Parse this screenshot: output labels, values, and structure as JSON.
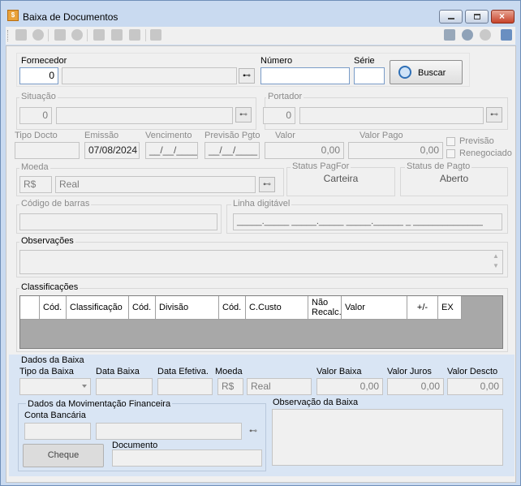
{
  "window": {
    "title": "Baixa de Documentos",
    "icon": "document-app-icon"
  },
  "fornecedor": {
    "label": "Fornecedor",
    "code": "0",
    "name": ""
  },
  "numero": {
    "label": "Número",
    "value": ""
  },
  "serie": {
    "label": "Série",
    "value": ""
  },
  "buscar": {
    "label": "Buscar"
  },
  "situacao": {
    "label": "Situação",
    "code": "0",
    "name": ""
  },
  "portador": {
    "label": "Portador",
    "code": "0",
    "name": ""
  },
  "tipo_docto": {
    "label": "Tipo Docto",
    "value": ""
  },
  "emissao": {
    "label": "Emissão",
    "value": "07/08/2024"
  },
  "vencimento": {
    "label": "Vencimento",
    "value": "__/__/____"
  },
  "previsao_pgto": {
    "label": "Previsão Pgto",
    "value": "__/__/____"
  },
  "valor": {
    "label": "Valor",
    "value": "0,00"
  },
  "valor_pago": {
    "label": "Valor Pago",
    "value": "0,00"
  },
  "previsao_chk": {
    "label": "Previsão"
  },
  "renegociado_chk": {
    "label": "Renegociado"
  },
  "moeda": {
    "label": "Moeda",
    "symbol": "R$",
    "name": "Real"
  },
  "status_pagfor": {
    "label": "Status PagFor",
    "value": "Carteira"
  },
  "status_pagto": {
    "label": "Status de Pagto",
    "value": "Aberto"
  },
  "codigo_barras": {
    "label": "Código de barras",
    "value": ""
  },
  "linha_digitavel": {
    "label": "Linha digitável",
    "value": "_____._____ _____._____ _____.______ _ ______________"
  },
  "observacoes": {
    "label": "Observações",
    "value": ""
  },
  "classificacoes": {
    "label": "Classificações",
    "columns": [
      "Cód.",
      "Classificação",
      "Cód.",
      "Divisão",
      "Cód.",
      "C.Custo",
      "Não Recalc.",
      "Valor",
      "+/-",
      "EX"
    ]
  },
  "dados_baixa": {
    "label": "Dados da Baixa",
    "tipo_label": "Tipo da Baixa",
    "data_baixa_label": "Data Baixa",
    "data_efetiva_label": "Data Efetiva.",
    "moeda_label": "Moeda",
    "moeda_symbol": "R$",
    "moeda_name": "Real",
    "valor_baixa_label": "Valor Baixa",
    "valor_baixa": "0,00",
    "valor_juros_label": "Valor Juros",
    "valor_juros": "0,00",
    "valor_descto_label": "Valor Descto",
    "valor_descto": "0,00"
  },
  "mov_financeira": {
    "label": "Dados da Movimentação Financeira",
    "conta_label": "Conta Bancária",
    "documento_label": "Documento",
    "cheque_label": "Cheque"
  },
  "observacao_baixa": {
    "label": "Observação da Baixa",
    "value": ""
  },
  "toolbar_icons": [
    "edit-icon",
    "cancel-icon",
    "save-icon",
    "undo-icon",
    "search-icon",
    "zoom-icon",
    "tools-icon",
    "pin-icon"
  ],
  "toolbar_right_icons": [
    "card-icon",
    "settings-icon",
    "user-icon",
    "panel-icon"
  ]
}
